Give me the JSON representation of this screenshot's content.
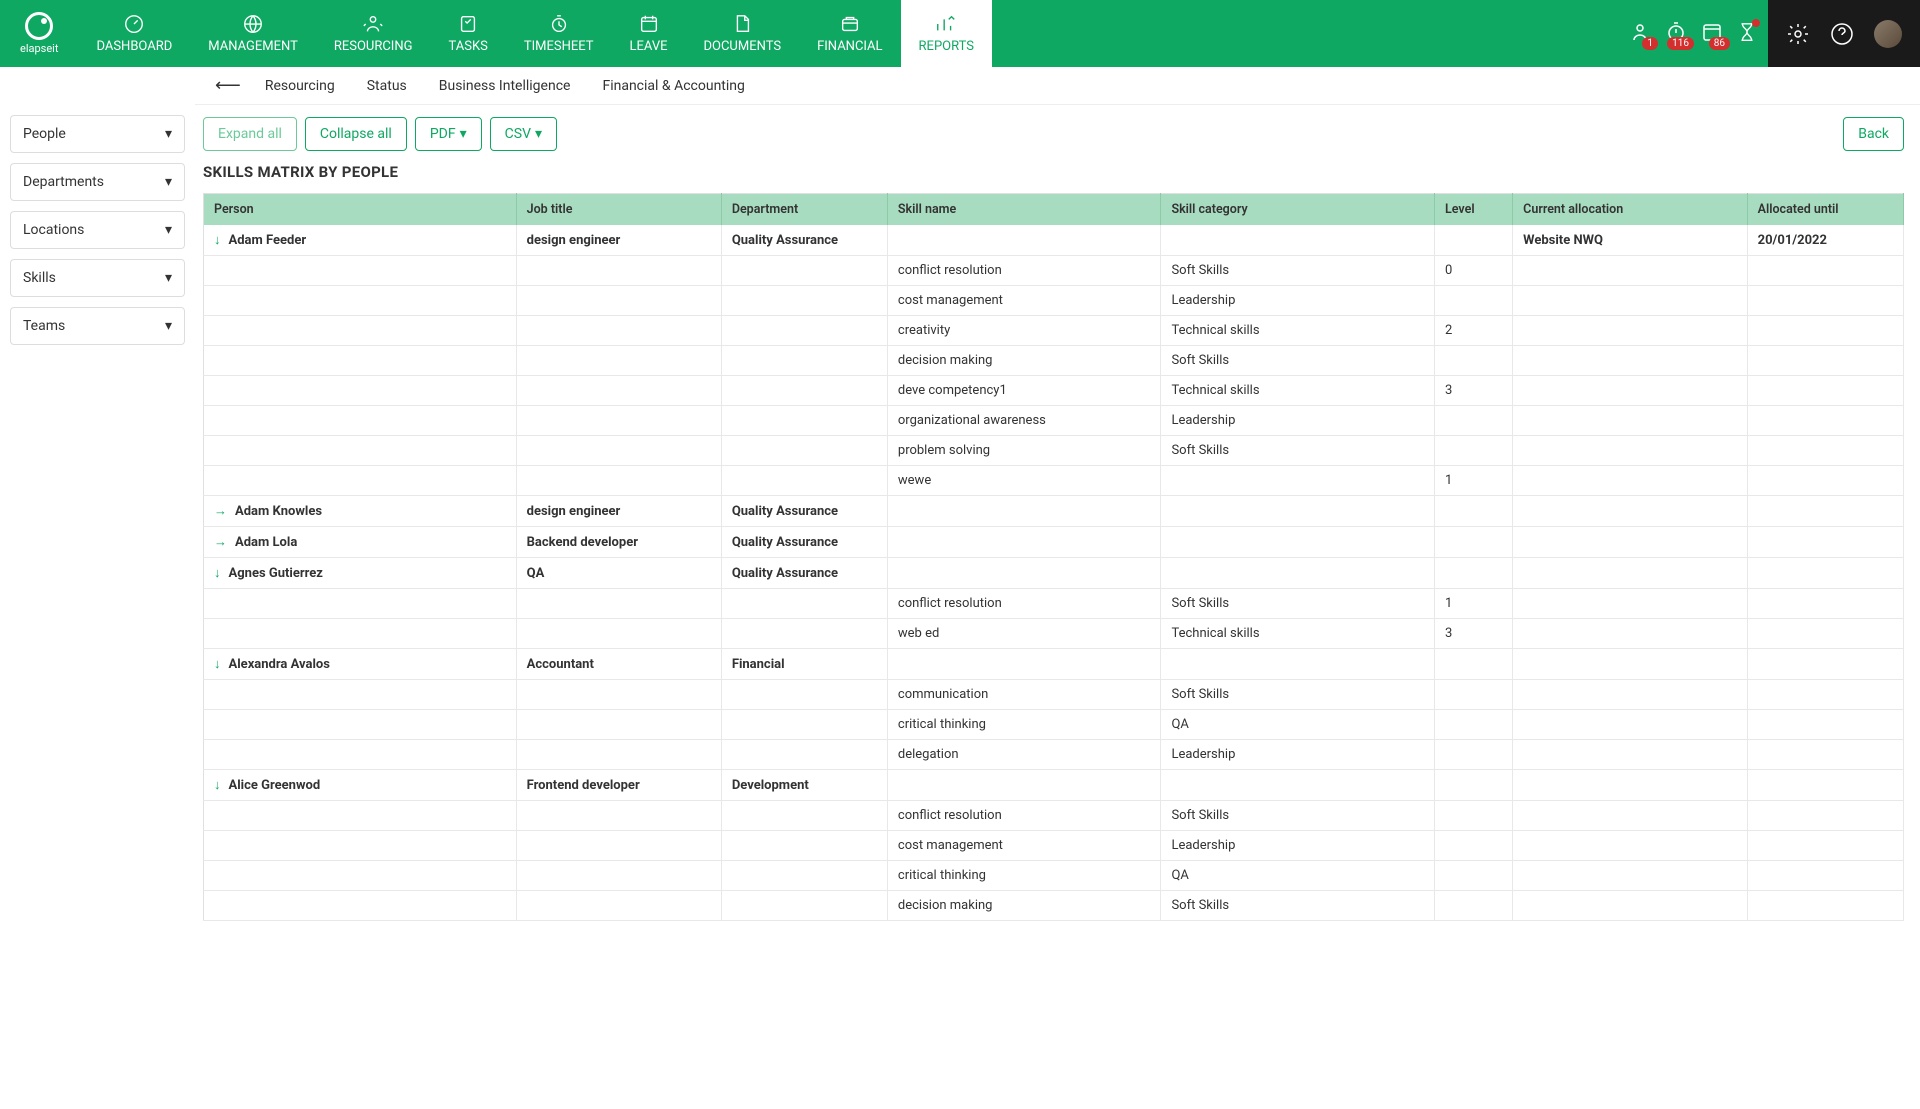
{
  "brand": "elapseit",
  "nav": [
    {
      "label": "DASHBOARD"
    },
    {
      "label": "MANAGEMENT"
    },
    {
      "label": "RESOURCING"
    },
    {
      "label": "TASKS"
    },
    {
      "label": "TIMESHEET"
    },
    {
      "label": "LEAVE"
    },
    {
      "label": "DOCUMENTS"
    },
    {
      "label": "FINANCIAL"
    },
    {
      "label": "REPORTS"
    }
  ],
  "badges": {
    "b1": "1",
    "b2": "116",
    "b3": "86"
  },
  "subnav": [
    {
      "label": "Resourcing"
    },
    {
      "label": "Status"
    },
    {
      "label": "Business Intelligence"
    },
    {
      "label": "Financial & Accounting"
    }
  ],
  "filters": [
    {
      "label": "People"
    },
    {
      "label": "Departments"
    },
    {
      "label": "Locations"
    },
    {
      "label": "Skills"
    },
    {
      "label": "Teams"
    }
  ],
  "toolbar": {
    "expand": "Expand all",
    "collapse": "Collapse all",
    "pdf": "PDF",
    "csv": "CSV",
    "back": "Back"
  },
  "pageTitle": "SKILLS MATRIX BY PEOPLE",
  "columns": {
    "person": "Person",
    "job": "Job title",
    "dept": "Department",
    "skill": "Skill name",
    "cat": "Skill category",
    "level": "Level",
    "alloc": "Current allocation",
    "until": "Allocated until"
  },
  "rows": [
    {
      "type": "person",
      "expand": "down",
      "person": "Adam Feeder",
      "job": "design engineer",
      "dept": "Quality Assurance",
      "alloc": "Website NWQ",
      "until": "20/01/2022"
    },
    {
      "type": "skill",
      "skill": "conflict resolution",
      "cat": "Soft Skills",
      "level": "0"
    },
    {
      "type": "skill",
      "skill": "cost management",
      "cat": "Leadership"
    },
    {
      "type": "skill",
      "skill": "creativity",
      "cat": "Technical skills",
      "level": "2"
    },
    {
      "type": "skill",
      "skill": "decision making",
      "cat": "Soft Skills"
    },
    {
      "type": "skill",
      "skill": "deve competency1",
      "cat": "Technical skills",
      "level": "3"
    },
    {
      "type": "skill",
      "skill": "organizational awareness",
      "cat": "Leadership"
    },
    {
      "type": "skill",
      "skill": "problem solving",
      "cat": "Soft Skills"
    },
    {
      "type": "skill",
      "skill": "wewe",
      "level": "1"
    },
    {
      "type": "person",
      "expand": "right",
      "person": "Adam Knowles",
      "job": "design engineer",
      "dept": "Quality Assurance"
    },
    {
      "type": "person",
      "expand": "right",
      "person": "Adam Lola",
      "job": "Backend developer",
      "dept": "Quality Assurance"
    },
    {
      "type": "person",
      "expand": "down",
      "person": "Agnes Gutierrez",
      "job": "QA",
      "dept": "Quality Assurance"
    },
    {
      "type": "skill",
      "skill": "conflict resolution",
      "cat": "Soft Skills",
      "level": "1"
    },
    {
      "type": "skill",
      "skill": "web ed",
      "cat": "Technical skills",
      "level": "3"
    },
    {
      "type": "person",
      "expand": "down",
      "person": "Alexandra Avalos",
      "job": "Accountant",
      "dept": "Financial"
    },
    {
      "type": "skill",
      "skill": "communication",
      "cat": "Soft Skills"
    },
    {
      "type": "skill",
      "skill": "critical thinking",
      "cat": "QA"
    },
    {
      "type": "skill",
      "skill": "delegation",
      "cat": "Leadership"
    },
    {
      "type": "person",
      "expand": "down",
      "person": "Alice Greenwod",
      "job": "Frontend developer",
      "dept": "Development"
    },
    {
      "type": "skill",
      "skill": "conflict resolution",
      "cat": "Soft Skills"
    },
    {
      "type": "skill",
      "skill": "cost management",
      "cat": "Leadership"
    },
    {
      "type": "skill",
      "skill": "critical thinking",
      "cat": "QA"
    },
    {
      "type": "skill",
      "skill": "decision making",
      "cat": "Soft Skills"
    }
  ]
}
